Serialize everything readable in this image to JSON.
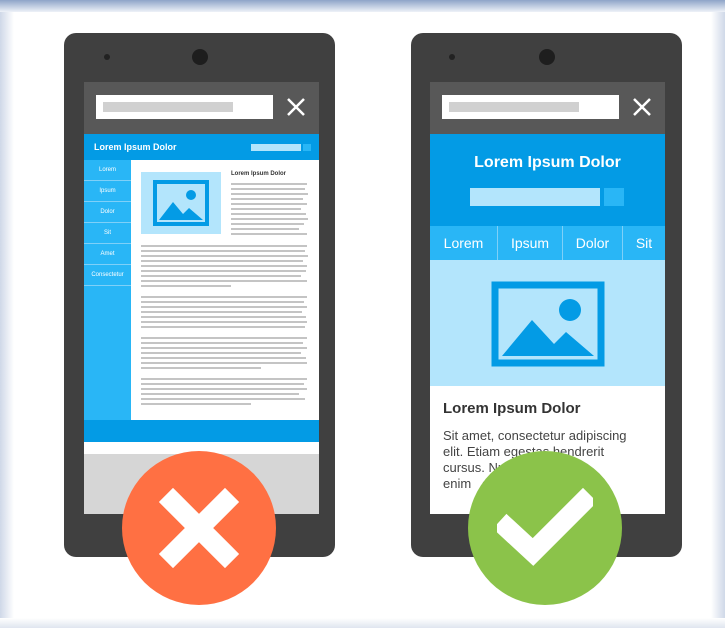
{
  "colors": {
    "phone_body": "#404040",
    "brand_blue": "#039be5",
    "light_blue": "#b3e5fc",
    "mid_blue": "#29b6f6",
    "bad_red": "#ff7043",
    "good_green": "#8bc34a"
  },
  "left_phone": {
    "header_title": "Lorem Ipsum Dolor",
    "nav": [
      "Lorem",
      "Ipsum",
      "Dolor",
      "Sit",
      "Amet",
      "Consectetur"
    ],
    "article_heading": "Lorem Ipsum Dolor",
    "status_icon": "close-icon"
  },
  "right_phone": {
    "header_title": "Lorem Ipsum Dolor",
    "nav": [
      "Lorem",
      "Ipsum",
      "Dolor",
      "Sit"
    ],
    "content_heading": "Lorem Ipsum Dolor",
    "content_lines": [
      "Sit amet, consectetur adipiscing",
      "elit. Etiam egestas hendrerit",
      "cursus. Nulla lectus ac",
      "enim   erat"
    ],
    "status_icon": "check-icon"
  }
}
